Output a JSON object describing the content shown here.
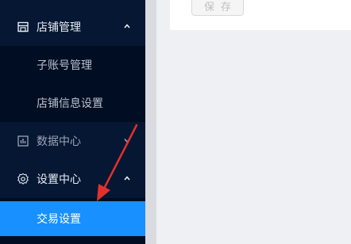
{
  "sidebar": {
    "groups": [
      {
        "label": "店铺管理",
        "icon": "store-icon",
        "expanded": true
      },
      {
        "label": "数据中心",
        "icon": "bar-chart-icon",
        "expanded": false
      },
      {
        "label": "设置中心",
        "icon": "gear-icon",
        "expanded": true
      }
    ],
    "store_items": [
      {
        "label": "子账号管理"
      },
      {
        "label": "店铺信息设置"
      }
    ],
    "settings_items": [
      {
        "label": "交易设置",
        "active": true
      }
    ]
  },
  "content": {
    "save_label": "保存"
  },
  "colors": {
    "sidebar_bg": "#061733",
    "submenu_bg": "#000d22",
    "active_bg": "#1890ff",
    "annotation_arrow": "#e0322b"
  }
}
